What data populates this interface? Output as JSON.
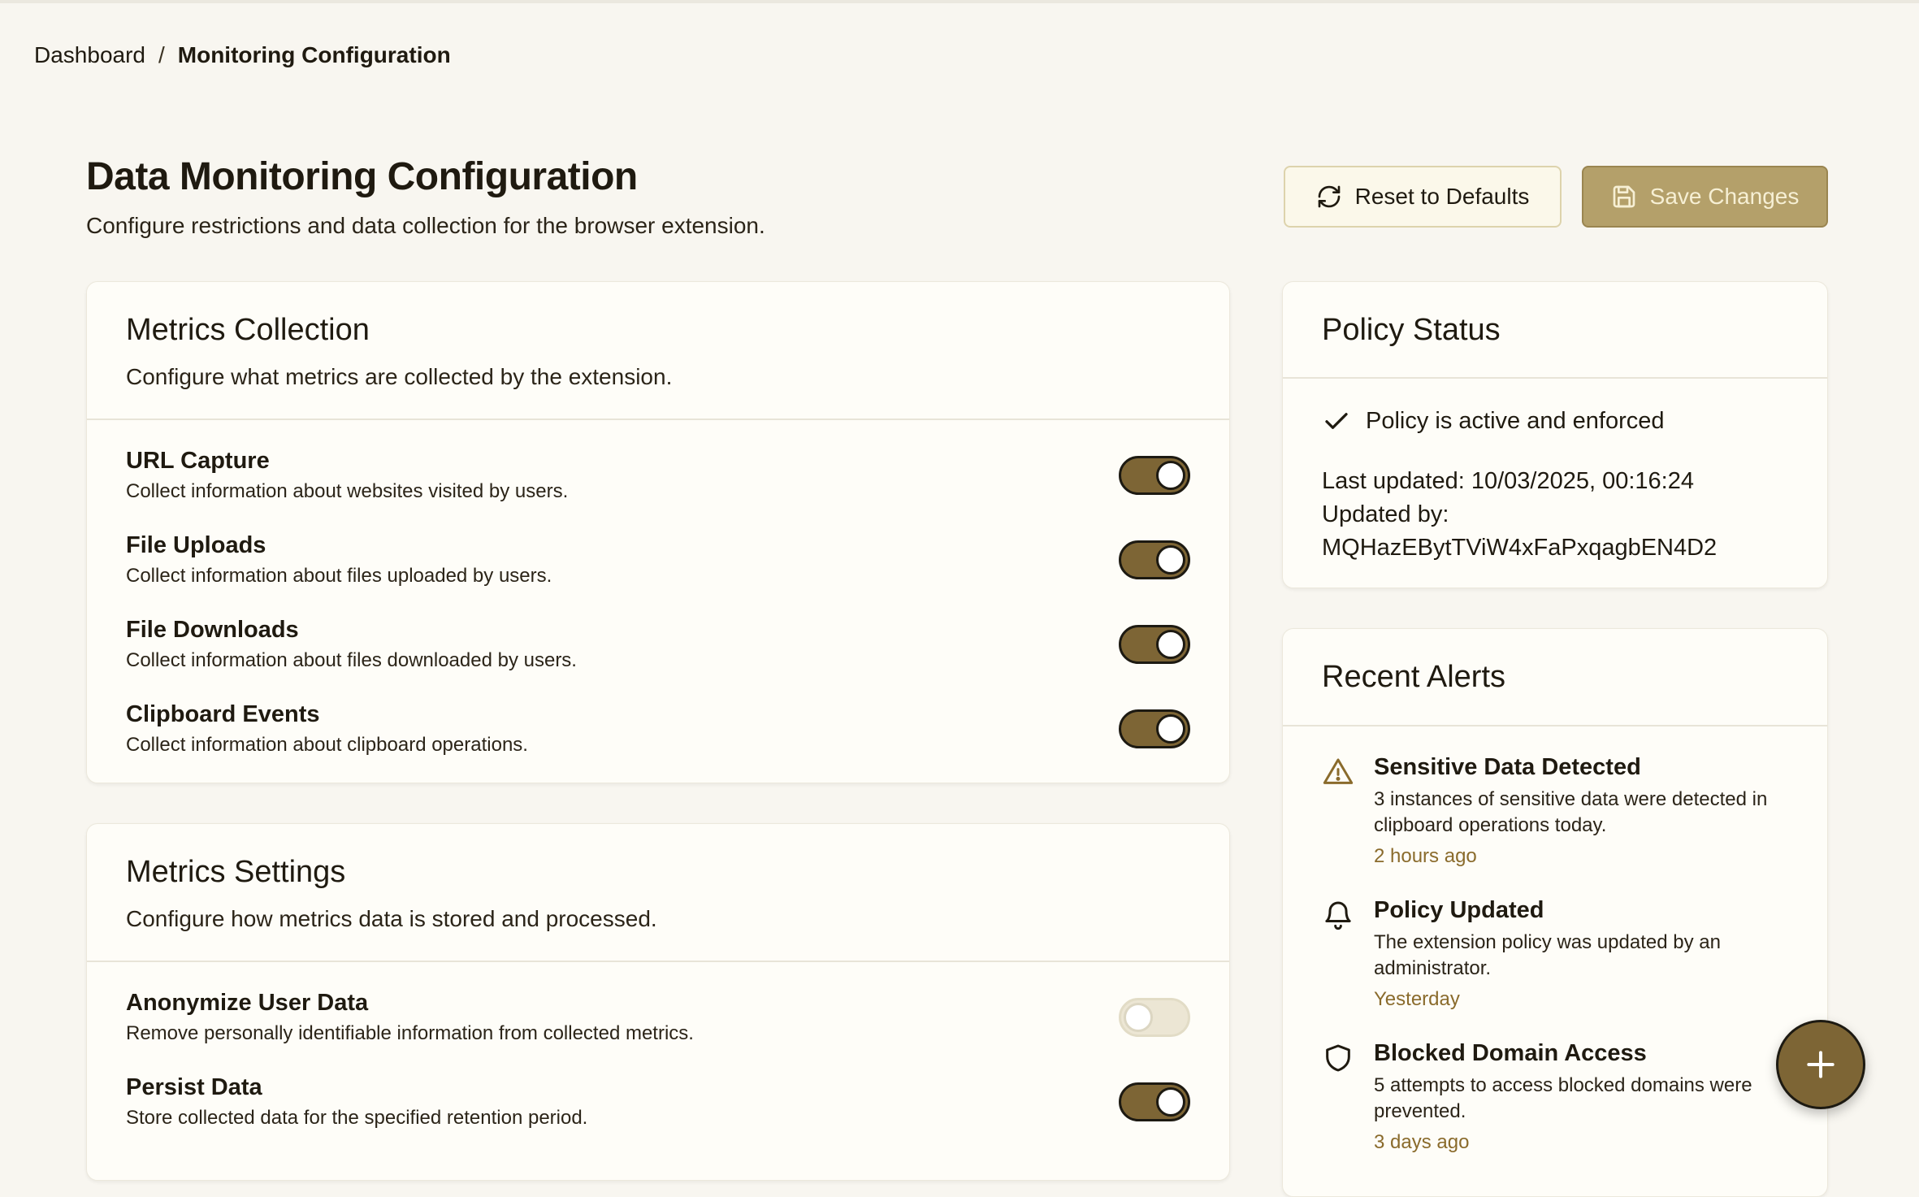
{
  "breadcrumb": {
    "home": "Dashboard",
    "separator": "/",
    "current": "Monitoring Configuration"
  },
  "page": {
    "title": "Data Monitoring Configuration",
    "subtitle": "Configure restrictions and data collection for the browser extension."
  },
  "actions": {
    "reset_label": "Reset to Defaults",
    "reset_icon": "refresh-icon",
    "save_label": "Save Changes",
    "save_icon": "save-icon"
  },
  "metrics_collection": {
    "title": "Metrics Collection",
    "description": "Configure what metrics are collected by the extension.",
    "items": [
      {
        "title": "URL Capture",
        "description": "Collect information about websites visited by users.",
        "enabled": true
      },
      {
        "title": "File Uploads",
        "description": "Collect information about files uploaded by users.",
        "enabled": true
      },
      {
        "title": "File Downloads",
        "description": "Collect information about files downloaded by users.",
        "enabled": true
      },
      {
        "title": "Clipboard Events",
        "description": "Collect information about clipboard operations.",
        "enabled": true
      }
    ]
  },
  "metrics_settings": {
    "title": "Metrics Settings",
    "description": "Configure how metrics data is stored and processed.",
    "items": [
      {
        "title": "Anonymize User Data",
        "description": "Remove personally identifiable information from collected metrics.",
        "enabled": false
      },
      {
        "title": "Persist Data",
        "description": "Store collected data for the specified retention period.",
        "enabled": true
      }
    ]
  },
  "policy_status": {
    "title": "Policy Status",
    "status_text": "Policy is active and enforced",
    "status_icon": "check-icon",
    "last_updated": "Last updated: 10/03/2025, 00:16:24",
    "updated_by_label": "Updated by:",
    "updated_by": "MQHazEBytTViW4xFaPxqagbEN4D2"
  },
  "recent_alerts": {
    "title": "Recent Alerts",
    "items": [
      {
        "icon": "warning-icon",
        "title": "Sensitive Data Detected",
        "description": "3 instances of sensitive data were detected in clipboard operations today.",
        "time": "2 hours ago"
      },
      {
        "icon": "bell-icon",
        "title": "Policy Updated",
        "description": "The extension policy was updated by an administrator.",
        "time": "Yesterday"
      },
      {
        "icon": "shield-icon",
        "title": "Blocked Domain Access",
        "description": "5 attempts to access blocked domains were prevented.",
        "time": "3 days ago"
      }
    ]
  },
  "fab": {
    "icon": "plus-icon"
  },
  "colors": {
    "background": "#f8f6f0",
    "accent": "#7d6535",
    "save_button": "#b4a06a",
    "time_text": "#8a6b2c"
  }
}
